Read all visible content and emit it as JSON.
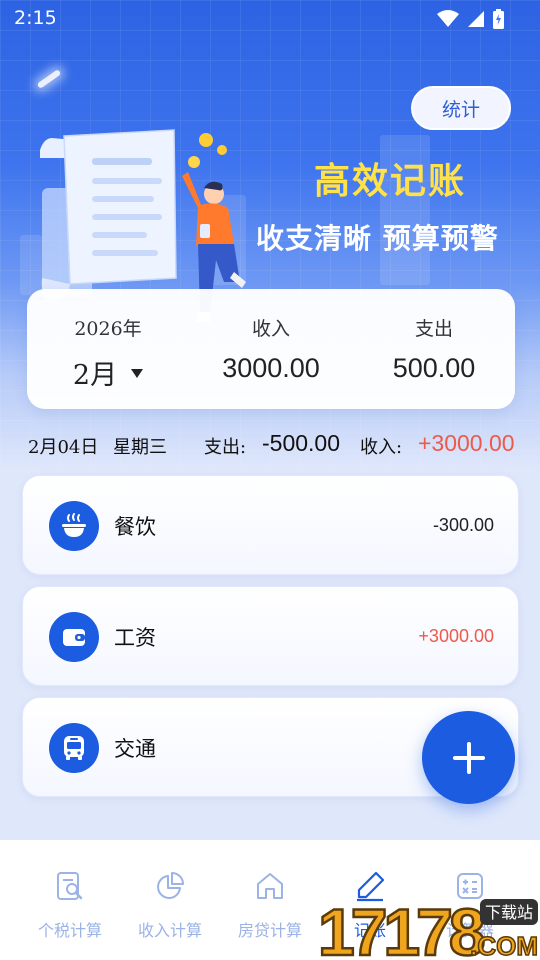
{
  "status_bar": {
    "time": "2:15"
  },
  "header": {
    "stats_button": "统计",
    "slogan_title": "高效记账",
    "slogan_subtitle": "收支清晰 预算预警"
  },
  "summary": {
    "year_label": "2026年",
    "month_value": "2月",
    "income_label": "收入",
    "income_value": "3000.00",
    "expense_label": "支出",
    "expense_value": "500.00"
  },
  "day": {
    "date": "2月04日",
    "weekday": "星期三",
    "expense_label": "支出:",
    "expense_value": "-500.00",
    "income_label": "收入:",
    "income_value": "+3000.00"
  },
  "records": [
    {
      "name": "餐饮",
      "amount": "-300.00",
      "icon": "bowl-icon",
      "amount_color": "#222222"
    },
    {
      "name": "工资",
      "amount": "+3000.00",
      "icon": "wallet-icon",
      "amount_color": "#ee5a4a"
    },
    {
      "name": "交通",
      "amount": "",
      "icon": "bus-icon",
      "amount_color": "#222222"
    }
  ],
  "tabs": [
    {
      "label": "个税计算",
      "icon": "tax-search-icon"
    },
    {
      "label": "收入计算",
      "icon": "pie-chart-icon"
    },
    {
      "label": "房贷计算",
      "icon": "house-icon"
    },
    {
      "label": "记账",
      "icon": "pen-icon",
      "active": true
    },
    {
      "label": "计算器",
      "icon": "calculator-icon"
    }
  ],
  "watermark": {
    "number": "17178",
    "badge": "下载站",
    "suffix": ".COM"
  },
  "colors": {
    "primary": "#1b5ce0",
    "income": "#ee5a4a",
    "slogan": "#ffe14a"
  }
}
